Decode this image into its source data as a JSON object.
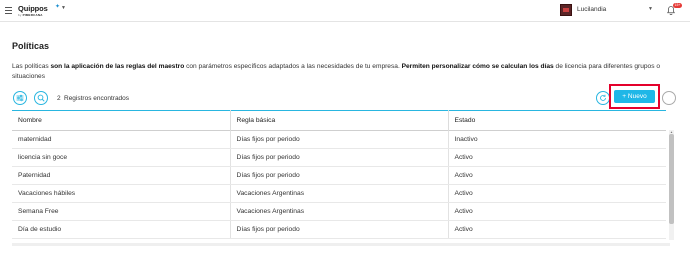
{
  "header": {
    "logo_text": "Quippos",
    "logo_subtitle_prefix": "by",
    "logo_subtitle_brand": "PIMERCANA",
    "company_name": "Lucilandia",
    "notification_count": "15+"
  },
  "page": {
    "title": "Políticas",
    "description": {
      "part1": "Las políticas ",
      "part2_bold": "son la aplicación de las reglas del maestro",
      "part3": " con parámetros específicos adaptados a las necesidades de tu empresa. ",
      "part4_bold": "Permiten personalizar cómo se calculan los días",
      "part5": " de licencia para diferentes grupos o situaciones"
    }
  },
  "toolbar": {
    "records_count": "2",
    "records_label": "Registros encontrados",
    "new_button_label": "Nuevo",
    "new_button_icon": "+"
  },
  "table": {
    "columns": [
      "Nombre",
      "Regla básica",
      "Estado"
    ],
    "rows": [
      [
        "maternidad",
        "Días fijos por periodo",
        "Inactivo"
      ],
      [
        "licencia sin goce",
        "Días fijos por periodo",
        "Activo"
      ],
      [
        "Paternidad",
        "Días fijos por periodo",
        "Activo"
      ],
      [
        "Vacaciones hábiles",
        "Vacaciones Argentinas",
        "Activo"
      ],
      [
        "Semana Free",
        "Vacaciones Argentinas",
        "Activo"
      ],
      [
        "Día de estudio",
        "Días fijos por periodo",
        "Activo"
      ]
    ]
  },
  "colors": {
    "accent": "#1fb7e7",
    "highlight_border": "#e4002b",
    "badge": "#e53935"
  }
}
